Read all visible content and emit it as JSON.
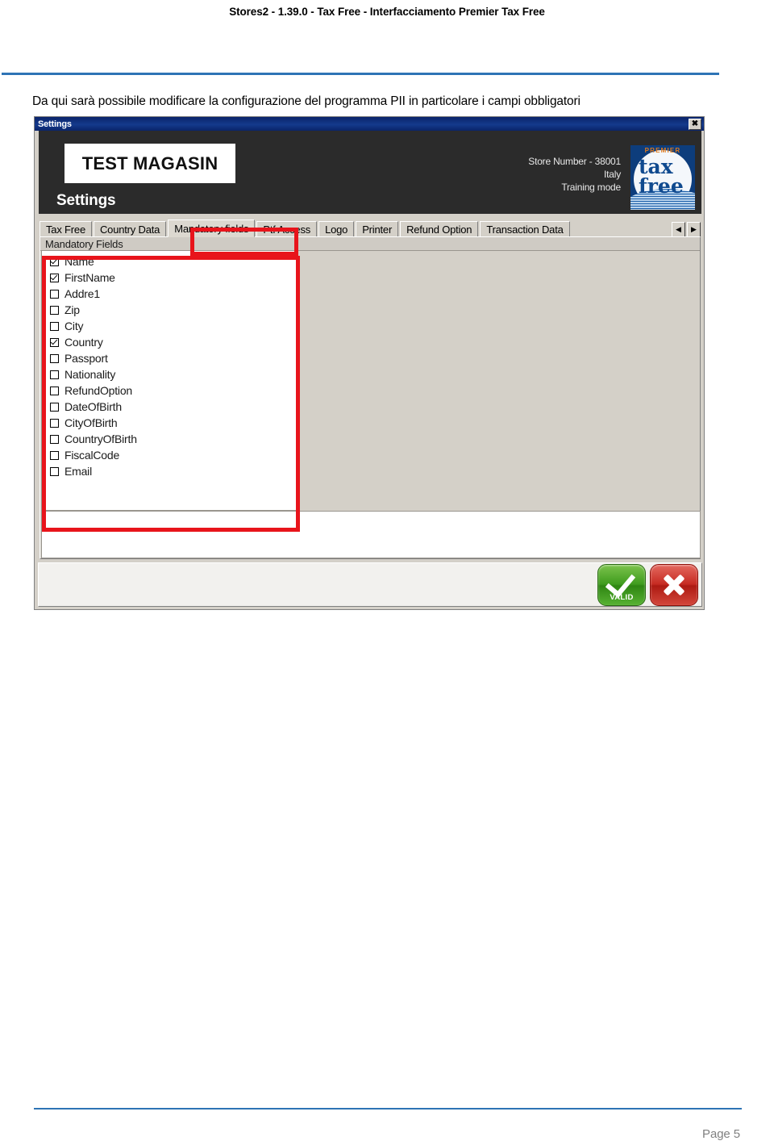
{
  "document": {
    "header_title": "Stores2 - 1.39.0 - Tax Free - Interfacciamento Premier Tax Free",
    "intro_text": "Da qui sarà possibile modificare la configurazione del programma PII in particolare i campi obbligatori",
    "page_number": "Page 5",
    "accent_color": "#2e74b5",
    "annotation_color": "#e8141b"
  },
  "app_window": {
    "titlebar": {
      "title": "Settings",
      "close_icon": "close-icon",
      "close_glyph": "✖"
    },
    "banner": {
      "store_logo_text": "TEST MAGASIN",
      "section_title": "Settings",
      "store_number": "Store Number - 38001",
      "country": "Italy",
      "mode": "Training mode",
      "logo": {
        "premier": "PREMIER",
        "tax": "tax",
        "free": "free"
      }
    },
    "tabs": [
      {
        "label": "Tax Free",
        "active": false
      },
      {
        "label": "Country Data",
        "active": false
      },
      {
        "label": "Mandatory fields",
        "active": true
      },
      {
        "label": "Ptf Access",
        "active": false
      },
      {
        "label": "Logo",
        "active": false
      },
      {
        "label": "Printer",
        "active": false
      },
      {
        "label": "Refund Option",
        "active": false
      },
      {
        "label": "Transaction Data",
        "active": false
      }
    ],
    "tab_scroll": {
      "prev_glyph": "◀",
      "next_glyph": "▶"
    },
    "panel": {
      "group_title": "Mandatory Fields",
      "fields": [
        {
          "label": "Name",
          "checked": true
        },
        {
          "label": "FirstName",
          "checked": true
        },
        {
          "label": "Addre1",
          "checked": false
        },
        {
          "label": "Zip",
          "checked": false
        },
        {
          "label": "City",
          "checked": false
        },
        {
          "label": "Country",
          "checked": true
        },
        {
          "label": "Passport",
          "checked": false
        },
        {
          "label": "Nationality",
          "checked": false
        },
        {
          "label": "RefundOption",
          "checked": false
        },
        {
          "label": "DateOfBirth",
          "checked": false
        },
        {
          "label": "CityOfBirth",
          "checked": false
        },
        {
          "label": "CountryOfBirth",
          "checked": false
        },
        {
          "label": "FiscalCode",
          "checked": false
        },
        {
          "label": "Email",
          "checked": false
        }
      ]
    },
    "buttons": {
      "valid_label": "VALID",
      "valid_icon": "checkmark-icon",
      "cancel_icon": "x-mark-icon"
    }
  }
}
